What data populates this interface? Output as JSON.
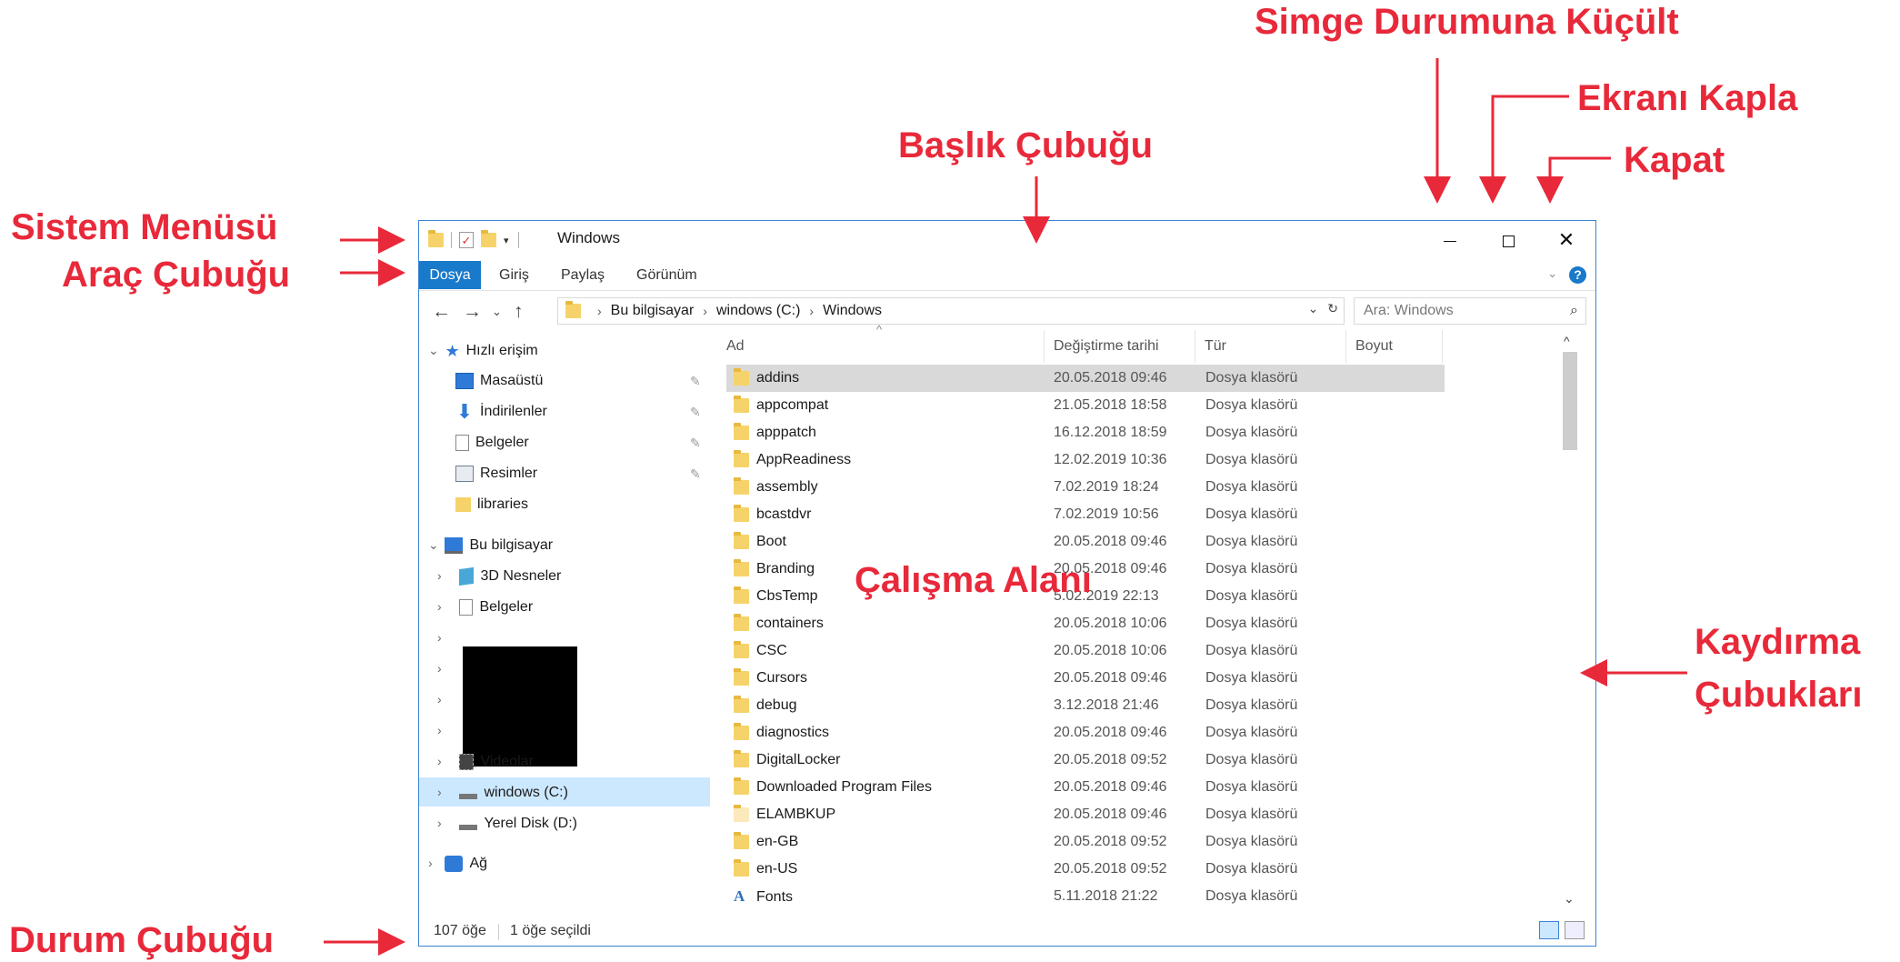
{
  "annotations": {
    "minimize": "Simge Durumuna Küçült",
    "maximize": "Ekranı Kapla",
    "close": "Kapat",
    "titlebar": "Başlık Çubuğu",
    "system_menu": "Sistem Menüsü",
    "toolbar": "Araç Çubuğu",
    "scrollbars_line1": "Kaydırma",
    "scrollbars_line2": "Çubukları",
    "workspace": "Çalışma Alanı",
    "statusbar": "Durum Çubuğu"
  },
  "window": {
    "title": "Windows",
    "minimize_icon": "minimize-icon",
    "maximize_icon": "maximize-icon",
    "close_icon": "close-icon",
    "accent": "#1979ca"
  },
  "ribbon": {
    "tabs": [
      "Dosya",
      "Giriş",
      "Paylaş",
      "Görünüm"
    ]
  },
  "address": {
    "crumbs": [
      "Bu bilgisayar",
      "windows (C:)",
      "Windows"
    ],
    "search_placeholder": "Ara: Windows"
  },
  "nav": {
    "quick_access": "Hızlı erişim",
    "quick_items": [
      "Masaüstü",
      "İndirilenler",
      "Belgeler",
      "Resimler",
      "libraries"
    ],
    "this_pc": "Bu bilgisayar",
    "pc_items": [
      "3D Nesneler",
      "Belgeler",
      "Videolar",
      "windows (C:)",
      "Yerel Disk (D:)"
    ],
    "network": "Ağ"
  },
  "columns": [
    "Ad",
    "Değiştirme tarihi",
    "Tür",
    "Boyut"
  ],
  "files": [
    {
      "name": "addins",
      "date": "20.05.2018 09:46",
      "type": "Dosya klasörü"
    },
    {
      "name": "appcompat",
      "date": "21.05.2018 18:58",
      "type": "Dosya klasörü"
    },
    {
      "name": "apppatch",
      "date": "16.12.2018 18:59",
      "type": "Dosya klasörü"
    },
    {
      "name": "AppReadiness",
      "date": "12.02.2019 10:36",
      "type": "Dosya klasörü"
    },
    {
      "name": "assembly",
      "date": "7.02.2019 18:24",
      "type": "Dosya klasörü"
    },
    {
      "name": "bcastdvr",
      "date": "7.02.2019 10:56",
      "type": "Dosya klasörü"
    },
    {
      "name": "Boot",
      "date": "20.05.2018 09:46",
      "type": "Dosya klasörü"
    },
    {
      "name": "Branding",
      "date": "20.05.2018 09:46",
      "type": "Dosya klasörü"
    },
    {
      "name": "CbsTemp",
      "date": "5.02.2019 22:13",
      "type": "Dosya klasörü"
    },
    {
      "name": "containers",
      "date": "20.05.2018 10:06",
      "type": "Dosya klasörü"
    },
    {
      "name": "CSC",
      "date": "20.05.2018 10:06",
      "type": "Dosya klasörü"
    },
    {
      "name": "Cursors",
      "date": "20.05.2018 09:46",
      "type": "Dosya klasörü"
    },
    {
      "name": "debug",
      "date": "3.12.2018 21:46",
      "type": "Dosya klasörü"
    },
    {
      "name": "diagnostics",
      "date": "20.05.2018 09:46",
      "type": "Dosya klasörü"
    },
    {
      "name": "DigitalLocker",
      "date": "20.05.2018 09:52",
      "type": "Dosya klasörü"
    },
    {
      "name": "Downloaded Program Files",
      "date": "20.05.2018 09:46",
      "type": "Dosya klasörü"
    },
    {
      "name": "ELAMBKUP",
      "date": "20.05.2018 09:46",
      "type": "Dosya klasörü"
    },
    {
      "name": "en-GB",
      "date": "20.05.2018 09:52",
      "type": "Dosya klasörü"
    },
    {
      "name": "en-US",
      "date": "20.05.2018 09:52",
      "type": "Dosya klasörü"
    },
    {
      "name": "Fonts",
      "date": "5.11.2018 21:22",
      "type": "Dosya klasörü"
    }
  ],
  "status": {
    "count": "107 öğe",
    "selected": "1 öğe seçildi"
  }
}
